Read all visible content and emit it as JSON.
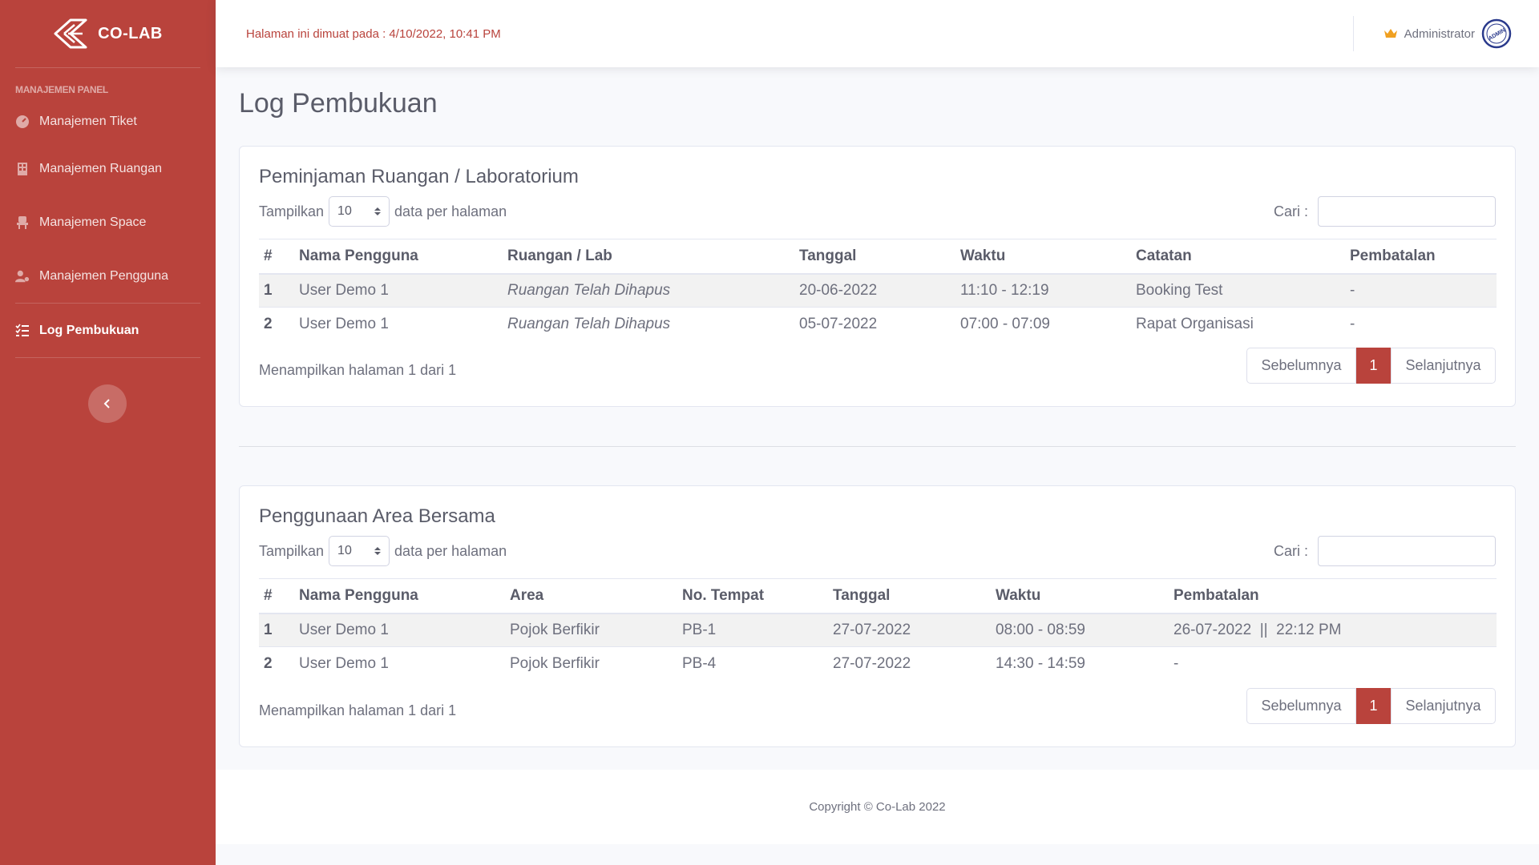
{
  "brand": {
    "name": "CO-LAB"
  },
  "sidebar": {
    "heading": "MANAJEMEN PANEL",
    "items": [
      {
        "label": "Manajemen Tiket",
        "icon": "dashboard-icon"
      },
      {
        "label": "Manajemen Ruangan",
        "icon": "building-icon"
      },
      {
        "label": "Manajemen Space",
        "icon": "chair-icon"
      },
      {
        "label": "Manajemen Pengguna",
        "icon": "user-cog-icon"
      },
      {
        "label": "Log Pembukuan",
        "icon": "list-check-icon",
        "active": true
      }
    ],
    "toggle_icon": "chevron-left-icon"
  },
  "topbar": {
    "loaded_text": "Halaman ini dimuat pada : 4/10/2022, 10:41 PM",
    "user_name": "Administrator",
    "crown_icon": "crown-icon",
    "avatar_text": "ADMIN"
  },
  "page": {
    "title": "Log Pembukuan"
  },
  "colors": {
    "primary": "#b9433c",
    "text": "#5a5c69",
    "muted": "#6e707e"
  },
  "room_table": {
    "title": "Peminjaman Ruangan / Laboratorium",
    "length_prefix": "Tampilkan",
    "length_value": "10",
    "length_suffix": "data per halaman",
    "search_label": "Cari :",
    "headers": [
      "#",
      "Nama Pengguna",
      "Ruangan / Lab",
      "Tanggal",
      "Waktu",
      "Catatan",
      "Pembatalan"
    ],
    "rows": [
      [
        "1",
        "User Demo 1",
        "Ruangan Telah Dihapus",
        "20-06-2022",
        "11:10 - 12:19",
        "Booking Test",
        "-"
      ],
      [
        "2",
        "User Demo 1",
        "Ruangan Telah Dihapus",
        "05-07-2022",
        "07:00 - 07:09",
        "Rapat Organisasi",
        "-"
      ]
    ],
    "info": "Menampilkan halaman 1 dari 1",
    "prev": "Sebelumnya",
    "page": "1",
    "next": "Selanjutnya"
  },
  "area_table": {
    "title": "Penggunaan Area Bersama",
    "length_prefix": "Tampilkan",
    "length_value": "10",
    "length_suffix": "data per halaman",
    "search_label": "Cari :",
    "headers": [
      "#",
      "Nama Pengguna",
      "Area",
      "No. Tempat",
      "Tanggal",
      "Waktu",
      "Pembatalan"
    ],
    "rows": [
      [
        "1",
        "User Demo 1",
        "Pojok Berfikir",
        "PB-1",
        "27-07-2022",
        "08:00 - 08:59",
        "26-07-2022  ||  22:12 PM"
      ],
      [
        "2",
        "User Demo 1",
        "Pojok Berfikir",
        "PB-4",
        "27-07-2022",
        "14:30 - 14:59",
        "-"
      ]
    ],
    "info": "Menampilkan halaman 1 dari 1",
    "prev": "Sebelumnya",
    "page": "1",
    "next": "Selanjutnya"
  },
  "footer": {
    "text": "Copyright © Co-Lab 2022"
  }
}
